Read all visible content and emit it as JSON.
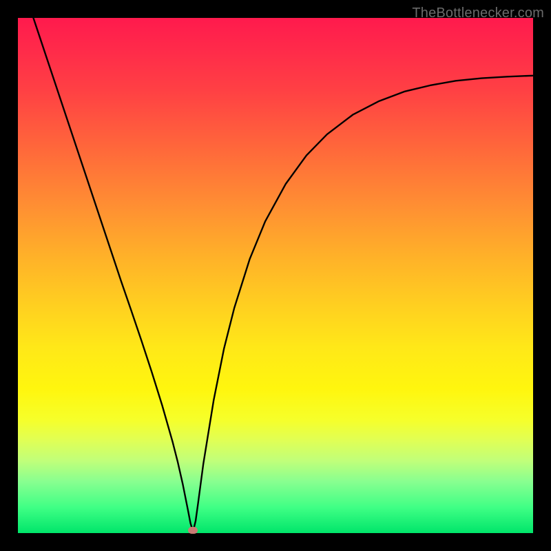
{
  "watermark": "TheBottleneсker.com",
  "chart_data": {
    "type": "line",
    "title": "",
    "xlabel": "",
    "ylabel": "",
    "xlim": [
      0,
      100
    ],
    "ylim": [
      0,
      100
    ],
    "series": [
      {
        "name": "bottleneck-curve",
        "x": [
          3,
          4,
          6,
          8,
          10,
          12,
          14,
          16,
          18,
          20,
          22,
          24,
          26,
          28,
          30,
          31,
          32,
          33,
          33.5,
          34,
          34.5,
          35,
          36,
          38,
          40,
          42,
          45,
          48,
          52,
          56,
          60,
          65,
          70,
          75,
          80,
          85,
          90,
          95,
          100
        ],
        "y": [
          100,
          97,
          91,
          85,
          79,
          73,
          67,
          61,
          55,
          49,
          43.2,
          37.3,
          31.2,
          24.8,
          17.8,
          13.9,
          9.5,
          4.5,
          1.9,
          0.3,
          2.4,
          6,
          13.5,
          25.8,
          35.8,
          43.7,
          53.2,
          60.5,
          67.8,
          73.3,
          77.4,
          81.2,
          83.8,
          85.7,
          86.9,
          87.8,
          88.3,
          88.6,
          88.8
        ]
      }
    ],
    "marker": {
      "x": 34,
      "y": 0.6,
      "label": "optimal-point"
    },
    "background": "rainbow-vertical-gradient"
  },
  "colors": {
    "curve": "#000000",
    "marker": "#c97b74",
    "frame": "#000000"
  }
}
